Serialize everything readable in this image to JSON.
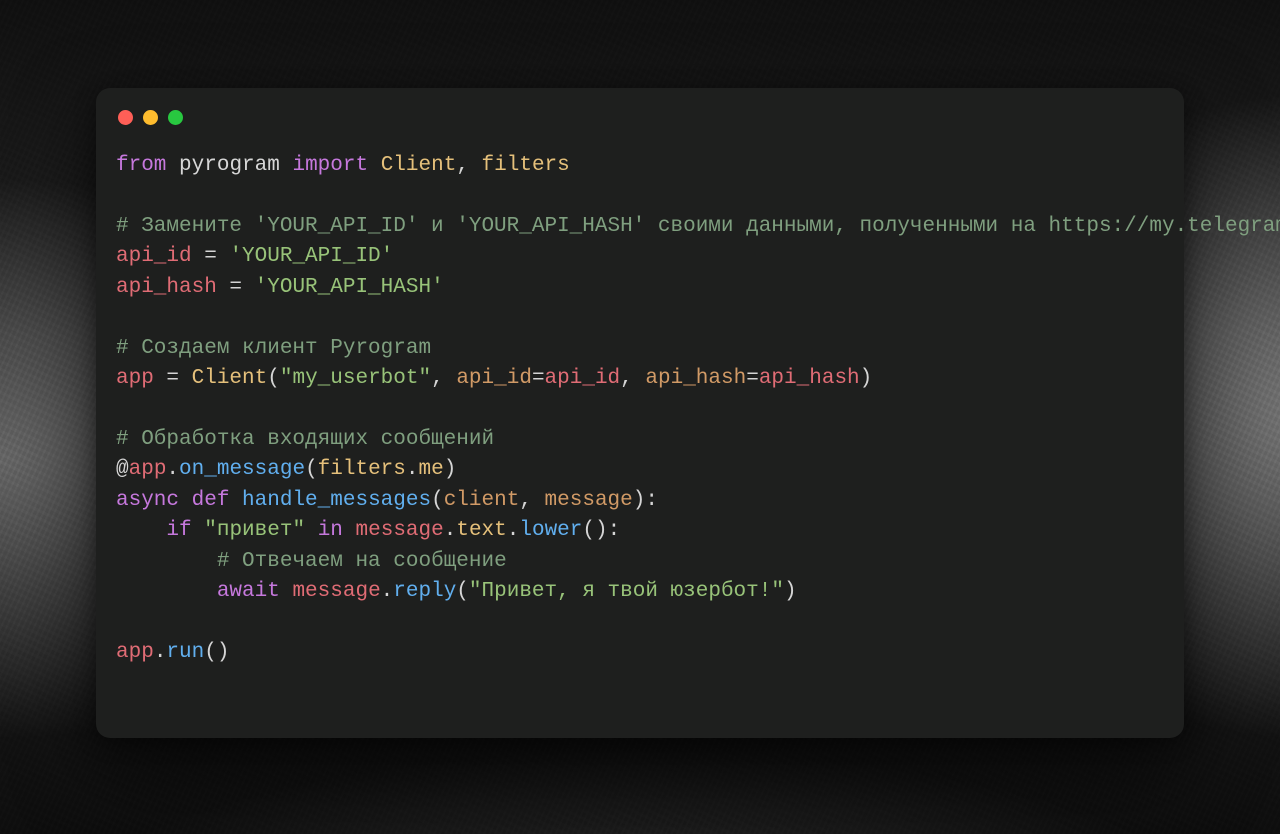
{
  "colors": {
    "window_bg": "#1e1f1e",
    "red": "#ff5f57",
    "yellow": "#febc2e",
    "green": "#28c840",
    "keyword": "#c678dd",
    "string": "#98c379",
    "comment": "#7f9f7f",
    "classname": "#e5c07b",
    "variable": "#e06c75",
    "function": "#61afef",
    "param": "#d19a66",
    "default": "#d5d5d5"
  },
  "code": {
    "l1": {
      "from": "from",
      "mod": "pyrogram",
      "import": "import",
      "cls1": "Client",
      "comma": ", ",
      "cls2": "filters"
    },
    "l3": "# Замените 'YOUR_API_ID' и 'YOUR_API_HASH' своими данными, полученными на https://my.telegram.org/apps",
    "l4": {
      "var": "api_id",
      "eq": " = ",
      "str": "'YOUR_API_ID'"
    },
    "l5": {
      "var": "api_hash",
      "eq": " = ",
      "str": "'YOUR_API_HASH'"
    },
    "l7": "# Создаем клиент Pyrogram",
    "l8": {
      "var": "app",
      "eq": " = ",
      "cls": "Client",
      "open": "(",
      "arg1": "\"my_userbot\"",
      "c1": ", ",
      "kw1": "api_id",
      "eq1": "=",
      "v1": "api_id",
      "c2": ", ",
      "kw2": "api_hash",
      "eq2": "=",
      "v2": "api_hash",
      "close": ")"
    },
    "l10": "# Обработка входящих сообщений",
    "l11": {
      "at": "@",
      "app": "app",
      "dot1": ".",
      "fn": "on_message",
      "open": "(",
      "flt": "filters",
      "dot2": ".",
      "me": "me",
      "close": ")"
    },
    "l12": {
      "async": "async",
      "def": "def",
      "name": "handle_messages",
      "open": "(",
      "p1": "client",
      "c": ", ",
      "p2": "message",
      "close": ")",
      ":": ":"
    },
    "l13": {
      "indent": "    ",
      "if": "if",
      "sp": " ",
      "str": "\"привет\"",
      "sp2": " ",
      "in": "in",
      "sp3": " ",
      "msg": "message",
      "dot": ".",
      "text": "text",
      "dot2": ".",
      "lower": "lower",
      "par": "()",
      ":": ":"
    },
    "l14": {
      "indent": "        ",
      "comm": "# Отвечаем на сообщение"
    },
    "l15": {
      "indent": "        ",
      "await": "await",
      "sp": " ",
      "msg": "message",
      "dot": ".",
      "reply": "reply",
      "open": "(",
      "str": "\"Привет, я твой юзербот!\"",
      "close": ")"
    },
    "l17": {
      "app": "app",
      "dot": ".",
      "run": "run",
      "par": "()"
    }
  }
}
